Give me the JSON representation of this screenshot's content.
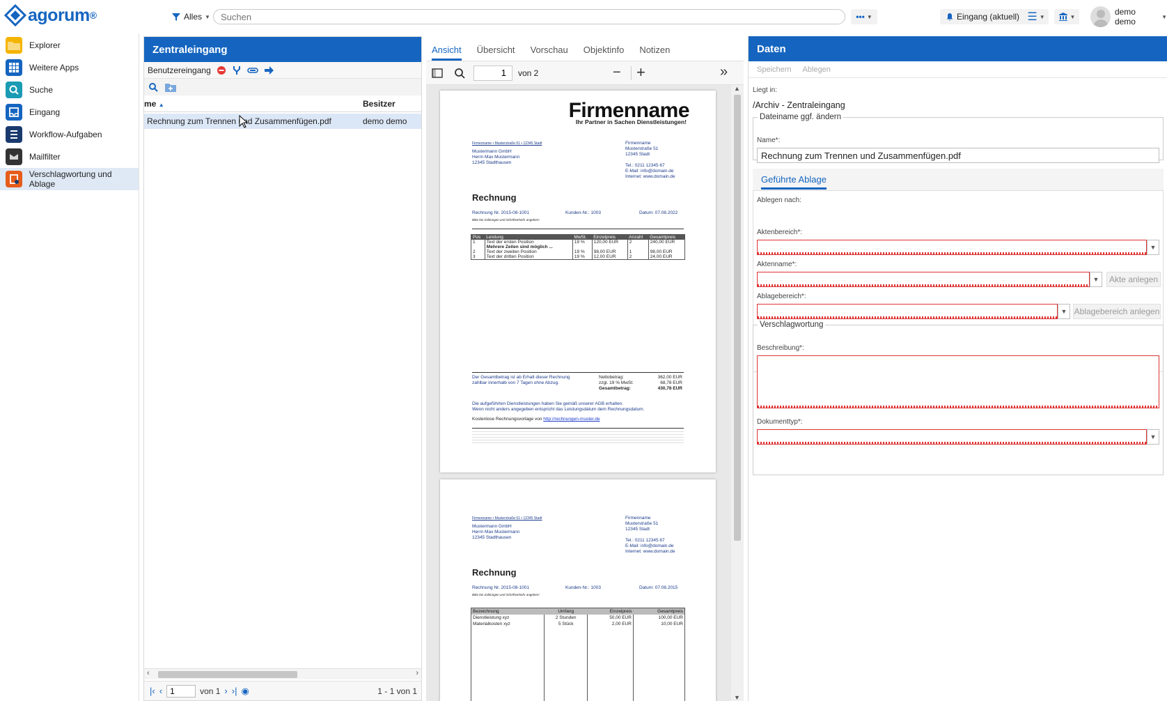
{
  "topbar": {
    "logo_text": "agorum",
    "logo_reg": "®",
    "filter_label": "Alles",
    "search_placeholder": "Suchen",
    "more_label": "•••",
    "inbox_label": "Eingang (aktuell)",
    "user_label": "demo demo"
  },
  "sidebar": {
    "items": [
      {
        "label": "Explorer",
        "icon": "folder-icon",
        "color": "#f5b400"
      },
      {
        "label": "Weitere Apps",
        "icon": "apps-grid-icon",
        "color": "#1565c0"
      },
      {
        "label": "Suche",
        "icon": "search-icon",
        "color": "#1a9bb4"
      },
      {
        "label": "Eingang",
        "icon": "inbox-icon",
        "color": "#1565c0"
      },
      {
        "label": "Workflow-Aufgaben",
        "icon": "workflow-icon",
        "color": "#1a3a6e"
      },
      {
        "label": "Mailfilter",
        "icon": "mailfilter-icon",
        "color": "#333333"
      },
      {
        "label": "Verschlagwortung und Ablage",
        "icon": "tagging-icon",
        "color": "#e65c1a"
      }
    ]
  },
  "inbox_panel": {
    "title": "Zentraleingang",
    "toolbar_label": "Benutzereingang",
    "col_name": "me",
    "col_owner": "Besitzer",
    "row": {
      "name": "Rechnung zum Trennen und Zusammenfügen.pdf",
      "owner": "demo demo"
    },
    "pager_page": "1",
    "pager_of": "von 1",
    "pager_count": "1 - 1 von 1"
  },
  "viewer_panel": {
    "tabs": [
      "Ansicht",
      "Übersicht",
      "Vorschau",
      "Objektinfo",
      "Notizen"
    ],
    "page_value": "1",
    "page_of": "von 2",
    "doc": {
      "company": "Firmenname",
      "slogan": "Ihr Partner in Sachen Dienstleistungen!",
      "sender_line": "Firmenname • Musterstraße 61 • 12345 Stadt",
      "recipient": [
        "Mustermann GmbH",
        "Herrn Max Mustermann",
        "12345 Stadthausen"
      ],
      "company_block": [
        "Firmenname",
        "Musterstraße 51",
        "12345 Stadt",
        "",
        "Tel.: 0211 12345 67",
        "E-Mail: info@domain.de",
        "Internet: www.domain.de"
      ],
      "heading": "Rechnung",
      "invoice_no": "Rechnung Nr. 2015-08-1001",
      "customer_no": "Kunden-Nr.: 1003",
      "date_p1": "Datum: 07.08.2022",
      "date_p2": "Datum: 07.08.2015",
      "note": "Bitte bei Zahlungen und Schriftverkehr angeben!",
      "table1_head": [
        "Pos",
        "Leistung",
        "MwSt.",
        "Einzelpreis",
        "Anzahl",
        "Gesamtpreis"
      ],
      "table1_rows": [
        [
          "1",
          "Text der ersten Position",
          "19 %",
          "120,00 EUR",
          "2",
          "240,00 EUR"
        ],
        [
          "",
          "Mehrere Zeilen sind möglich ...",
          "",
          "",
          "",
          ""
        ],
        [
          "2",
          "Text der zweiten Position",
          "19 %",
          "98,00 EUR",
          "1",
          "98,00 EUR"
        ],
        [
          "3",
          "Text der dritten Position",
          "19 %",
          "12,00 EUR",
          "2",
          "24,00 EUR"
        ]
      ],
      "total_text": [
        "Der Gesamtbetrag ist ab Erhalt dieser Rechnung",
        "zahlbar innerhalb von 7 Tagen ohne Abzug."
      ],
      "totals": [
        [
          "Nettobetrag:",
          "362,00 EUR"
        ],
        [
          "zzgl. 19 % MwSt:",
          "68,78 EUR"
        ],
        [
          "Gesamtbetrag:",
          "430,78 EUR"
        ]
      ],
      "agb": [
        "Die aufgeführten Dienstleistungen haben Sie gemäß unserer AGB erhalten.",
        "Wenn nicht anders angegeben entspricht das Leistungsdatum dem Rechnungsdatum."
      ],
      "template_prefix": "Kostenlose Rechnungsvorlage von",
      "template_link": "http://rechnungen-muster.de",
      "table2_head": [
        "Bezeichnung",
        "Umfang",
        "Einzelpreis",
        "Gesamtpreis"
      ],
      "table2_rows": [
        [
          "Dienstleistung xyz",
          "2 Stunden",
          "50,00 EUR",
          "100,00 EUR"
        ],
        [
          "Materialkosten xyz",
          "5 Stück",
          "2,00 EUR",
          "10,00 EUR"
        ]
      ]
    }
  },
  "data_panel": {
    "title": "Daten",
    "save_label": "Speichern",
    "file_label": "Ablegen",
    "location_label": "Liegt in:",
    "location_value": "/Archiv - Zentraleingang",
    "rename_legend": "Dateiname ggf. ändern",
    "name_label": "Name*:",
    "name_value": "Rechnung zum Trennen und Zusammenfügen.pdf",
    "guided_tab": "Geführte Ablage",
    "file_to_label": "Ablegen nach:",
    "aktenbereich_label": "Aktenbereich*:",
    "aktenname_label": "Aktenname*:",
    "akte_anlegen": "Akte anlegen",
    "ablagebereich_label": "Ablagebereich*:",
    "ablagebereich_anlegen": "Ablagebereich anlegen",
    "tagging_legend": "Verschlagwortung",
    "beschreibung_label": "Beschreibung*:",
    "dokumenttyp_label": "Dokumenttyp*:"
  }
}
